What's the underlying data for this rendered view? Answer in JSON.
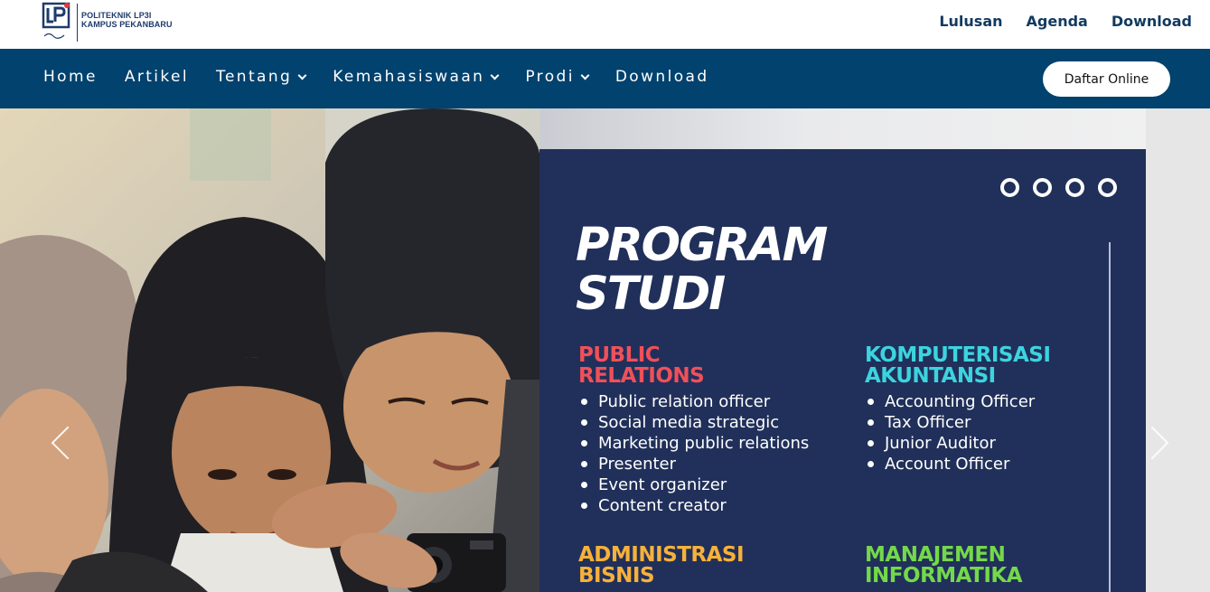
{
  "brand": {
    "line1": "POLITEKNIK LP3I",
    "line2": "KAMPUS PEKANBARU",
    "logo_icon": "lp3i-logo-icon"
  },
  "top_links": [
    {
      "label": "Lulusan"
    },
    {
      "label": "Agenda"
    },
    {
      "label": "Download"
    }
  ],
  "nav": {
    "items": [
      {
        "label": "Home",
        "dropdown": false
      },
      {
        "label": "Artikel",
        "dropdown": false
      },
      {
        "label": "Tentang",
        "dropdown": true
      },
      {
        "label": "Kemahasiswaan",
        "dropdown": true
      },
      {
        "label": "Prodi",
        "dropdown": true
      },
      {
        "label": "Download",
        "dropdown": false
      }
    ],
    "cta": "Daftar Online"
  },
  "slide": {
    "title_line1": "PROGRAM",
    "title_line2": "STUDI",
    "programs": [
      {
        "head1": "PUBLIC",
        "head2": "RELATIONS",
        "color": "#f0505a",
        "items": [
          "Public relation officer",
          "Social media strategic",
          "Marketing public relations",
          "Presenter",
          "Event organizer",
          "Content creator"
        ]
      },
      {
        "head1": "KOMPUTERISASI",
        "head2": "AKUNTANSI",
        "color": "#3cd4df",
        "items": [
          "Accounting Officer",
          "Tax Officer",
          "Junior Auditor",
          "Account Officer"
        ]
      },
      {
        "head1": "ADMINISTRASI",
        "head2": "BISNIS",
        "color": "#f7b13a",
        "items": []
      },
      {
        "head1": "MANAJEMEN",
        "head2": "INFORMATIKA",
        "color": "#74d94a",
        "items": []
      }
    ],
    "dots_count": 4
  },
  "colors": {
    "nav_bg": "#02426e",
    "panel_bg": "#21305a",
    "top_link": "#123a5f"
  }
}
